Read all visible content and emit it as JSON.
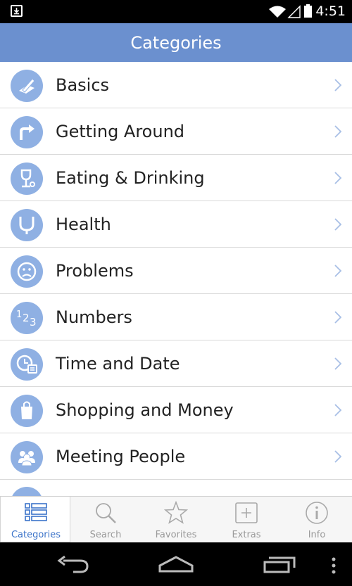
{
  "status_bar": {
    "time": "4:51"
  },
  "header": {
    "title": "Categories"
  },
  "categories": [
    {
      "label": "Basics",
      "icon": "pencil-paper-icon"
    },
    {
      "label": "Getting Around",
      "icon": "turn-arrow-icon"
    },
    {
      "label": "Eating & Drinking",
      "icon": "wine-glass-icon"
    },
    {
      "label": "Health",
      "icon": "stethoscope-icon"
    },
    {
      "label": "Problems",
      "icon": "sad-face-icon"
    },
    {
      "label": "Numbers",
      "icon": "numbers-123-icon"
    },
    {
      "label": "Time and Date",
      "icon": "clock-calendar-icon"
    },
    {
      "label": "Shopping and Money",
      "icon": "shopping-bag-icon"
    },
    {
      "label": "Meeting People",
      "icon": "people-icon"
    }
  ],
  "tabs": [
    {
      "label": "Categories",
      "icon": "list-icon",
      "active": true
    },
    {
      "label": "Search",
      "icon": "search-icon",
      "active": false
    },
    {
      "label": "Favorites",
      "icon": "star-icon",
      "active": false
    },
    {
      "label": "Extras",
      "icon": "plus-box-icon",
      "active": false
    },
    {
      "label": "Info",
      "icon": "info-icon",
      "active": false
    }
  ],
  "colors": {
    "header": "#6b90cf",
    "icon_bg": "#8fb0e3",
    "active_tab": "#3b73c9"
  }
}
